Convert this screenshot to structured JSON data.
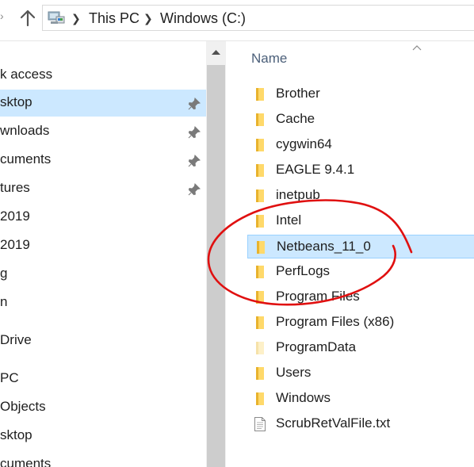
{
  "breadcrumb": {
    "items": [
      "This PC",
      "Windows (C:)"
    ]
  },
  "nav": {
    "items": [
      {
        "label": "k access",
        "pinned": false
      },
      {
        "label": "sktop",
        "pinned": true,
        "selected": true
      },
      {
        "label": "wnloads",
        "pinned": true
      },
      {
        "label": "cuments",
        "pinned": true
      },
      {
        "label": "tures",
        "pinned": true
      },
      {
        "label": "2019",
        "pinned": false
      },
      {
        "label": "2019",
        "pinned": false
      },
      {
        "label": "g",
        "pinned": false
      },
      {
        "label": "n",
        "pinned": false
      },
      {
        "label": "Drive",
        "pinned": false
      },
      {
        "label": "PC",
        "pinned": false
      },
      {
        "label": "Objects",
        "pinned": false
      },
      {
        "label": "sktop",
        "pinned": false
      },
      {
        "label": "cuments",
        "pinned": false
      }
    ]
  },
  "content": {
    "column_name": "Name",
    "files": [
      {
        "name": "Brother",
        "type": "folder"
      },
      {
        "name": "Cache",
        "type": "folder"
      },
      {
        "name": "cygwin64",
        "type": "folder"
      },
      {
        "name": "EAGLE 9.4.1",
        "type": "folder"
      },
      {
        "name": "inetpub",
        "type": "folder"
      },
      {
        "name": "Intel",
        "type": "folder"
      },
      {
        "name": "Netbeans_11_0",
        "type": "folder",
        "selected": true
      },
      {
        "name": "PerfLogs",
        "type": "folder"
      },
      {
        "name": "Program Files",
        "type": "folder"
      },
      {
        "name": "Program Files (x86)",
        "type": "folder"
      },
      {
        "name": "ProgramData",
        "type": "folder-hidden"
      },
      {
        "name": "Users",
        "type": "folder"
      },
      {
        "name": "Windows",
        "type": "folder"
      },
      {
        "name": "ScrubRetValFile.txt",
        "type": "text-file"
      }
    ]
  },
  "icons": {
    "forward": "chevron-right-icon",
    "up": "arrow-up-icon",
    "location": "this-pc-icon",
    "pin": "pin-icon",
    "folder": "folder-icon",
    "file": "text-file-icon"
  },
  "colors": {
    "selection": "#cce8ff",
    "selection_border": "#99d1ff",
    "folder": "#ffd96a",
    "annotation": "#e01010",
    "column_header": "#4c607a"
  }
}
